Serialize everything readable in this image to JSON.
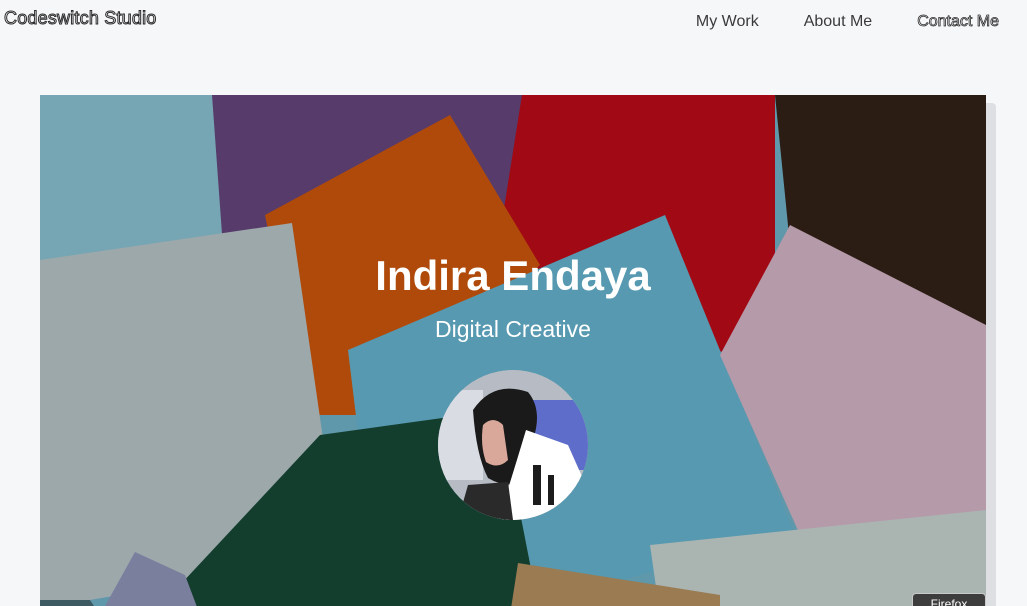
{
  "header": {
    "brand": "Codeswitch Studio",
    "nav": [
      {
        "label": "My Work"
      },
      {
        "label": "About Me"
      },
      {
        "label": "Contact Me"
      }
    ]
  },
  "hero": {
    "name": "Indira Endaya",
    "tagline": "Digital Creative",
    "background": "abstract overlapping colored paper squares",
    "avatar": "profile-photo"
  },
  "browser": {
    "badge": "Firefox"
  },
  "colors": {
    "page_bg": "#f6f7f9",
    "hero_text": "#ffffff",
    "nav_text": "#3a3a3a"
  }
}
